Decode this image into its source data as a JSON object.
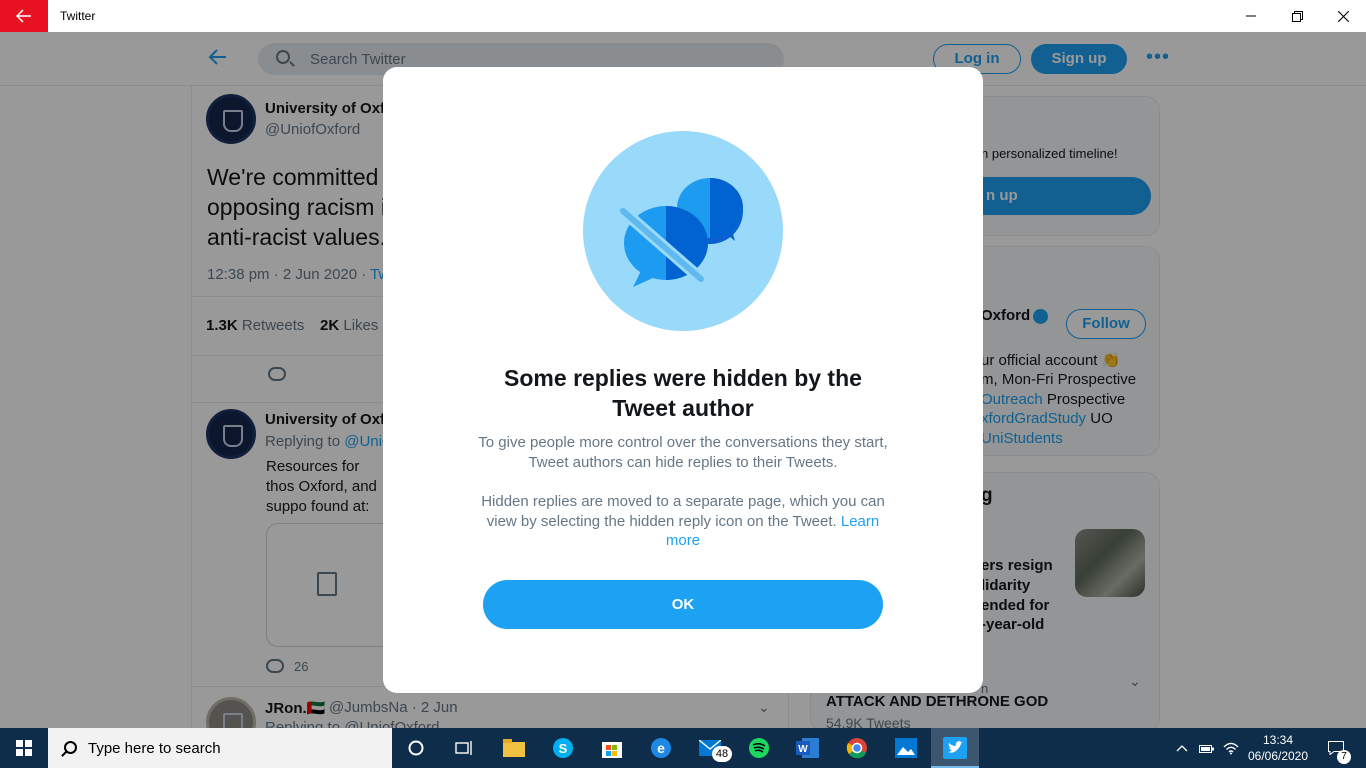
{
  "window": {
    "title": "Twitter",
    "back_icon": "back-arrow-icon",
    "min_symbol": "—",
    "restore_symbol": "❐",
    "close_symbol": "✕"
  },
  "header": {
    "search_placeholder": "Search Twitter",
    "login_label": "Log in",
    "signup_label": "Sign up",
    "more_symbol": "•••"
  },
  "tweet": {
    "name": "University of Oxf",
    "handle": "@UniofOxford",
    "text_lines": [
      "We're committed",
      "opposing racism i",
      "anti-racist values."
    ],
    "time": "12:38 pm · 2 Jun 2020 · ",
    "source_fragment": "Twi",
    "retweets_count": "1.3K",
    "retweets_label": "Retweets",
    "likes_count": "2K",
    "likes_label": "Likes"
  },
  "reply1": {
    "name": "University of Oxf",
    "replying_label": "Replying to ",
    "replying_handle": "@Unic",
    "body": "Resources for thos Oxford, and suppo found at:",
    "reply_count": "26"
  },
  "reply2": {
    "name": "JRon.🇦🇪",
    "handle": "@JumbsNa · 2 Jun",
    "replying": "Replying to @UniofOxford"
  },
  "sidebar": {
    "timeline_text": "n personalized timeline!",
    "signup_fragment": "n up",
    "profile_name": "Oxford",
    "follow_label": "Follow",
    "bio_lines": [
      "ur official account 👏",
      "m, Mon-Fri Prospective",
      "Prospective"
    ],
    "bio_link1": "Outreach",
    "bio_link2": "xfordGradStudy",
    "bio_text_uo": " UO",
    "bio_link3": "UniStudents",
    "trends_header": "g",
    "trend_lines": [
      "ers resign",
      "lidarity",
      "ended for",
      "-year-old"
    ],
    "trend_small": "n",
    "trend_title": "ATTACK AND DETHRONE GOD",
    "trend_count": "54.9K Tweets"
  },
  "modal": {
    "title": "Some replies were hidden by the Tweet author",
    "description": "To give people more control over the conversations they start, Tweet authors can hide replies to their Tweets.",
    "description2": "Hidden replies are moved to a separate page, which you can view by selecting the hidden reply icon on the Tweet. ",
    "learn_more": "Learn more",
    "ok_label": "OK",
    "illustration": "hidden-replies-icon"
  },
  "taskbar": {
    "search_placeholder": "Type here to search",
    "mail_badge": "48",
    "time": "13:34",
    "date": "06/06/2020",
    "notification_count": "7"
  },
  "colors": {
    "twitter_blue": "#1da1f2",
    "taskbar_bg": "#0e2d4a",
    "back_button_red": "#e81123"
  }
}
